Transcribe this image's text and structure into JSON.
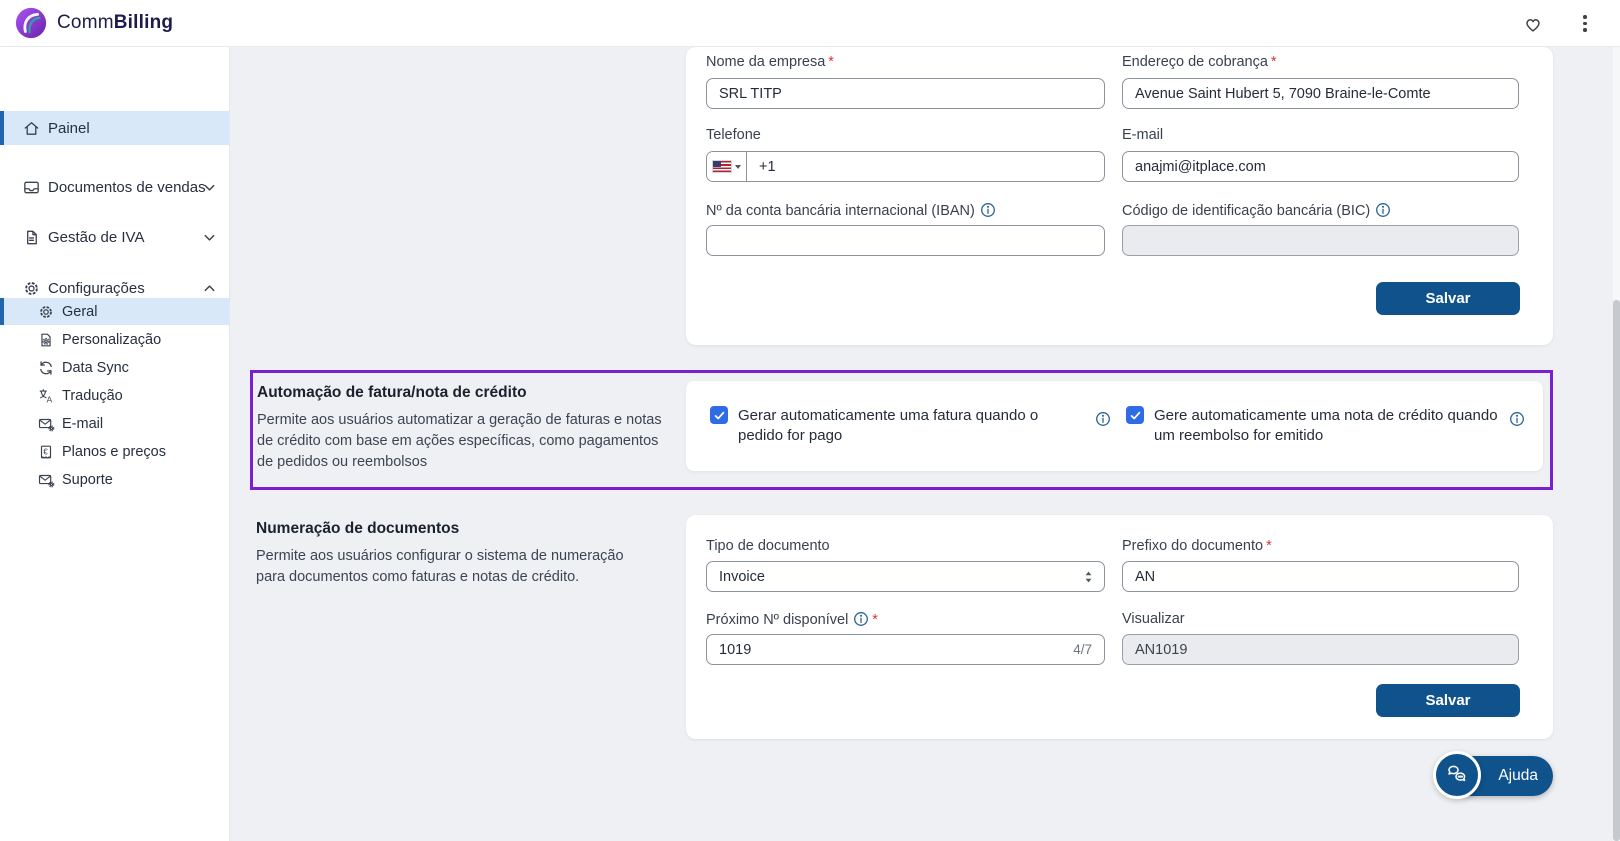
{
  "brand": {
    "prefix": "Comm",
    "suffix": "Billing"
  },
  "ui": {
    "required_mark": "*"
  },
  "header_icons": {
    "favorite": "heart-icon",
    "menu": "kebab-menu-icon"
  },
  "sidebar": {
    "items": [
      {
        "label": "Painel",
        "icon": "home-icon",
        "active": true
      },
      {
        "label": "Documentos de vendas",
        "icon": "inbox-icon",
        "chevron": "down"
      },
      {
        "label": "Gestão de IVA",
        "icon": "document-icon",
        "chevron": "down"
      },
      {
        "label": "Configurações",
        "icon": "gear-icon",
        "chevron": "up"
      }
    ],
    "sub": [
      {
        "label": "Geral",
        "icon": "gear-icon",
        "active": true
      },
      {
        "label": "Personalização",
        "icon": "document-gear-icon"
      },
      {
        "label": "Data Sync",
        "icon": "sync-icon"
      },
      {
        "label": "Tradução",
        "icon": "translate-icon"
      },
      {
        "label": "E-mail",
        "icon": "mail-gear-icon"
      },
      {
        "label": "Planos e preços",
        "icon": "receipt-euro-icon"
      },
      {
        "label": "Suporte",
        "icon": "mail-gear-icon"
      }
    ]
  },
  "company": {
    "name_label": "Nome da empresa",
    "name_value": "SRL TITP",
    "address_label": "Endereço de cobrança",
    "address_value": "Avenue Saint Hubert 5, 7090 Braine-le-Comte",
    "phone_label": "Telefone",
    "phone_code": "+1",
    "email_label": "E-mail",
    "email_value": "anajmi@itplace.com",
    "iban_label": "Nº da conta bancária internacional (IBAN)",
    "bic_label": "Código de identificação bancária (BIC)",
    "save": "Salvar"
  },
  "automation": {
    "title": "Automação de fatura/nota de crédito",
    "description": "Permite aos usuários automatizar a geração de faturas e notas de crédito com base em ações específicas, como pagamentos de pedidos ou reembolsos",
    "checkbox1": "Gerar automaticamente uma fatura quando o pedido for pago",
    "checkbox1_checked": true,
    "checkbox2": "Gere automaticamente uma nota de crédito quando um reembolso for emitido",
    "checkbox2_checked": true
  },
  "numbering": {
    "title": "Numeração de documentos",
    "description": "Permite aos usuários configurar o sistema de numeração para documentos como faturas e notas de crédito.",
    "doc_type_label": "Tipo de documento",
    "doc_type_value": "Invoice",
    "prefix_label": "Prefixo do documento",
    "prefix_value": "AN",
    "next_label": "Próximo Nº disponível",
    "next_value": "1019",
    "next_counter": "4/7",
    "preview_label": "Visualizar",
    "preview_value": "AN1019",
    "save": "Salvar"
  },
  "help": {
    "label": "Ajuda"
  },
  "colors": {
    "primary_button": "#0F528C",
    "accent_purple": "#7B1FD2",
    "checkbox_blue": "#2E6BE5",
    "active_item_bg": "#D9E8F8",
    "active_item_bar": "#2166AC",
    "page_bg": "#EEF0F3",
    "required_red": "#D23B2F"
  }
}
